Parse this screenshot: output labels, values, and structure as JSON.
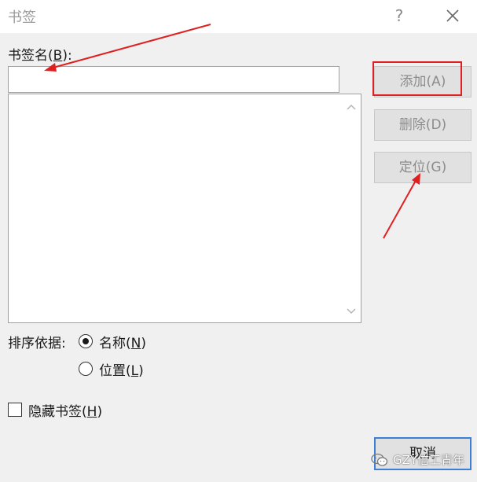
{
  "window": {
    "title": "书签",
    "help_glyph": "?"
  },
  "form": {
    "name_label_prefix": "书签名(",
    "name_label_key": "B",
    "name_label_suffix": "):",
    "name_value": "",
    "bookmarks": []
  },
  "buttons": {
    "add": "添加(A)",
    "delete": "删除(D)",
    "goto": "定位(G)",
    "cancel": "取消"
  },
  "sort": {
    "label": "排序依据:",
    "options": [
      {
        "prefix": "名称(",
        "key": "N",
        "suffix": ")",
        "checked": true
      },
      {
        "prefix": "位置(",
        "key": "L",
        "suffix": ")",
        "checked": false
      }
    ]
  },
  "hidden_bookmarks": {
    "prefix": "隐藏书签(",
    "key": "H",
    "suffix": ")",
    "checked": false
  },
  "watermark": {
    "text": "GZY信工青年",
    "icon": "wechat-icon"
  },
  "colors": {
    "annotation_red": "#e02020",
    "default_button_border": "#3c7fd6",
    "disabled_text": "#8c8c8c"
  }
}
